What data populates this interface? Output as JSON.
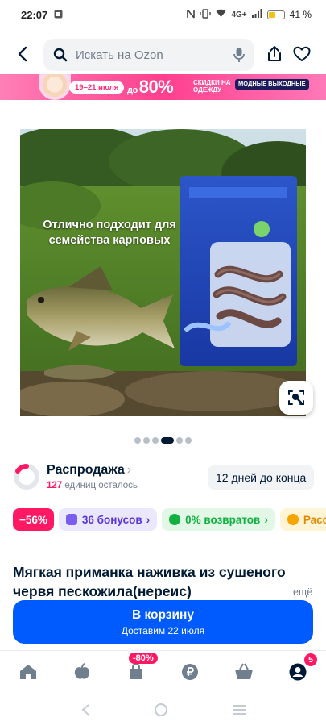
{
  "status_bar": {
    "time": "22:07",
    "network": "4G+",
    "battery": "41 %"
  },
  "header": {
    "search_placeholder": "Искать на Ozon"
  },
  "promo_banner": {
    "dates": "19–21 июля",
    "prefix": "до",
    "discount": "80%",
    "text": "СКИДКИ НА ОДЕЖДУ",
    "tag": "МОДНЫЕ ВЫХОДНЫЕ"
  },
  "gallery": {
    "caption": "Отлично подходит для семейства карповых",
    "slide_count": 6,
    "active_slide": 4
  },
  "sale": {
    "title": "Распродажа",
    "units_count": "127",
    "units_text": "единиц осталось",
    "deadline": "12 дней до конца"
  },
  "chips": [
    {
      "label": "−56%"
    },
    {
      "label": "36 бонусов"
    },
    {
      "label": "0% возвратов"
    },
    {
      "label": "Расср"
    }
  ],
  "product": {
    "title": "Мягкая приманка наживка из сушеного червя пескожила(нереис)",
    "more": "ещё"
  },
  "cart_button": {
    "label": "В корзину",
    "delivery": "Доставим 22 июля"
  },
  "tab_bar": {
    "sale_badge": "-80%",
    "cart_count": "5"
  },
  "colors": {
    "accent": "#005bff",
    "pink": "#ff1864"
  }
}
